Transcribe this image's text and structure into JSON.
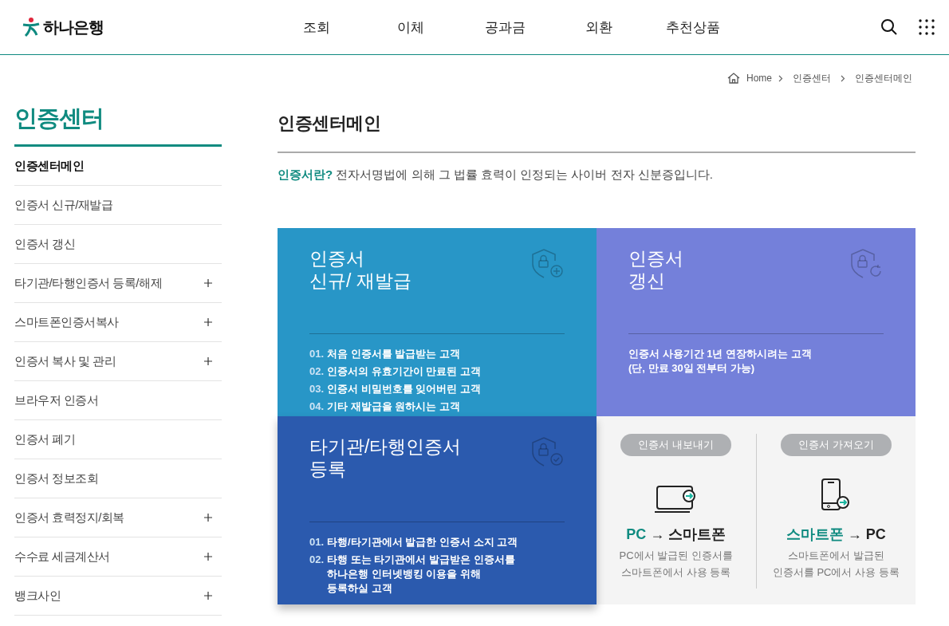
{
  "header": {
    "logo": "하나은행",
    "nav": [
      "조회",
      "이체",
      "공과금",
      "외환",
      "추천상품"
    ]
  },
  "breadcrumb": [
    "Home",
    "인증센터",
    "인증센터메인"
  ],
  "sidebar": {
    "title": "인증센터",
    "items": [
      {
        "label": "인증센터메인",
        "selected": true,
        "has_submenu": false
      },
      {
        "label": "인증서 신규/재발급",
        "selected": false,
        "has_submenu": false
      },
      {
        "label": "인증서 갱신",
        "selected": false,
        "has_submenu": false
      },
      {
        "label": "타기관/타행인증서 등록/해제",
        "selected": false,
        "has_submenu": true
      },
      {
        "label": "스마트폰인증서복사",
        "selected": false,
        "has_submenu": true
      },
      {
        "label": "인증서 복사 및 관리",
        "selected": false,
        "has_submenu": true
      },
      {
        "label": "브라우저 인증서",
        "selected": false,
        "has_submenu": false
      },
      {
        "label": "인증서 폐기",
        "selected": false,
        "has_submenu": false
      },
      {
        "label": "인증서 정보조회",
        "selected": false,
        "has_submenu": false
      },
      {
        "label": "인증서 효력정지/회복",
        "selected": false,
        "has_submenu": true
      },
      {
        "label": "수수료 세금계산서",
        "selected": false,
        "has_submenu": true
      },
      {
        "label": "뱅크사인",
        "selected": false,
        "has_submenu": true
      }
    ]
  },
  "main": {
    "title": "인증센터메인",
    "intro": {
      "term": "인증서란?",
      "text": "전자서명법에 의해 그 법률 효력이 인정되는 사이버 전자 신분증입니다."
    },
    "tiles": [
      {
        "kind": "info",
        "color": "#2896c7",
        "title_lines": [
          "인증서",
          "신규/ 재발급"
        ],
        "items": [
          {
            "number": "01.",
            "lines": [
              "처음 인증서를 발급받는 고객"
            ]
          },
          {
            "number": "02.",
            "lines": [
              "인증서의 유효기간이 만료된 고객"
            ]
          },
          {
            "number": "03.",
            "lines": [
              "인증서 비밀번호를 잊어버린 고객"
            ]
          },
          {
            "number": "04.",
            "lines": [
              "기타 재발급을 원하시는 고객"
            ]
          }
        ]
      },
      {
        "kind": "info",
        "color": "#7480da",
        "title_lines": [
          "인증서",
          "갱신"
        ],
        "items": [
          {
            "lines": [
              "인증서 사용기간 1년 연장하시려는 고객",
              "(단, 만료 30일 전부터 가능)"
            ]
          }
        ]
      },
      {
        "kind": "info",
        "color": "#2b5aae",
        "title_lines": [
          "타기관/타행인증서",
          "등록"
        ],
        "items": [
          {
            "number": "01.",
            "lines": [
              "타행/타기관에서 발급한 인증서 소지 고객"
            ]
          },
          {
            "number": "02.",
            "lines": [
              "타행 또는 타기관에서 발급받은 인증서를",
              "하나은행 인터넷뱅킹 이용을 위해",
              "등록하실 고객"
            ]
          }
        ]
      },
      {
        "kind": "transfer",
        "color": "#f4f4f4",
        "columns": [
          {
            "label": "인증서 내보내기",
            "highlight": "PC",
            "rest": "→ 스마트폰",
            "lines": [
              "PC에서 발급된 인증서를",
              "스마트폰에서 사용 등록"
            ]
          },
          {
            "label": "인증서 가져오기",
            "highlight": "스마트폰",
            "rest": "→ PC",
            "lines": [
              "스마트폰에서 발급된",
              "인증서를 PC에서 사용 등록"
            ]
          }
        ]
      }
    ]
  }
}
